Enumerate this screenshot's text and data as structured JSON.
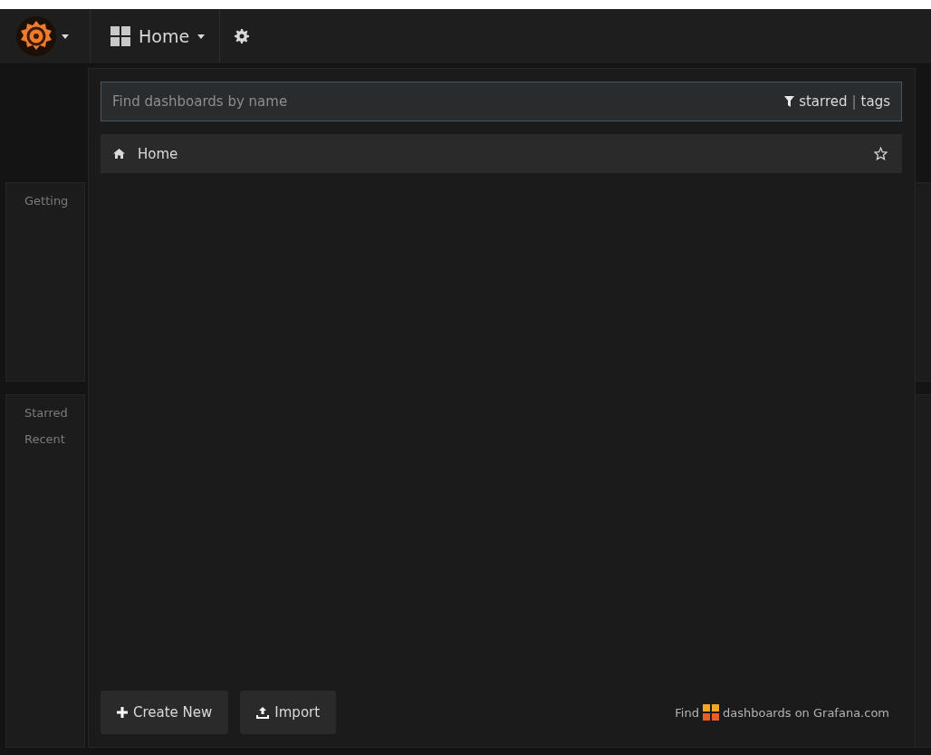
{
  "navbar": {
    "dashboard_title": "Home"
  },
  "background_panels": [
    {
      "lines": [
        "Getting"
      ]
    },
    {
      "lines": [
        "Starred",
        "Recent"
      ]
    }
  ],
  "search_dropdown": {
    "placeholder": "Find dashboards by name",
    "filter_starred": "starred",
    "filter_separator": "|",
    "filter_tags": "tags",
    "results": [
      {
        "title": "Home",
        "starred": false
      }
    ],
    "buttons": [
      {
        "kind": "create",
        "label": "Create New"
      },
      {
        "kind": "import",
        "label": "Import"
      }
    ],
    "footer_prefix": "Find",
    "footer_suffix": "dashboards on Grafana.com"
  }
}
